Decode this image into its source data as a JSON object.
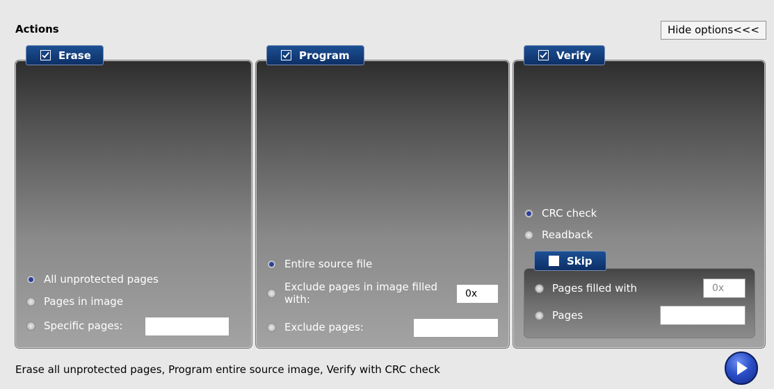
{
  "header": {
    "title": "Actions",
    "hide_options_label": "Hide options<<<"
  },
  "erase": {
    "tab_label": "Erase",
    "checked": true,
    "options": [
      {
        "label": "All unprotected pages",
        "selected": true
      },
      {
        "label": "Pages in image",
        "selected": false
      },
      {
        "label": "Specific pages:",
        "selected": false
      }
    ],
    "specific_pages_value": ""
  },
  "program": {
    "tab_label": "Program",
    "checked": true,
    "options": [
      {
        "label": "Entire source file",
        "selected": true
      },
      {
        "label_line1": "Exclude pages in image filled",
        "label_line2": "with:",
        "selected": false
      },
      {
        "label": "Exclude pages:",
        "selected": false
      }
    ],
    "fill_value": "0x",
    "exclude_pages_value": ""
  },
  "verify": {
    "tab_label": "Verify",
    "checked": true,
    "options": [
      {
        "label": "CRC check",
        "selected": true
      },
      {
        "label": "Readback",
        "selected": false
      }
    ],
    "skip": {
      "tab_label": "Skip",
      "checked": false,
      "options": [
        {
          "label": "Pages filled with",
          "selected": false
        },
        {
          "label": "Pages",
          "selected": false
        }
      ],
      "fill_value": "0x",
      "pages_value": ""
    }
  },
  "status_text": "Erase all unprotected pages, Program entire source image, Verify with CRC check",
  "colors": {
    "tab_blue": "#0d3066",
    "radio_selected": "#2b3f9a",
    "go_button": "#2b4fc9"
  },
  "icons": {
    "go": "play-arrow-icon",
    "checkbox": "check-icon"
  }
}
